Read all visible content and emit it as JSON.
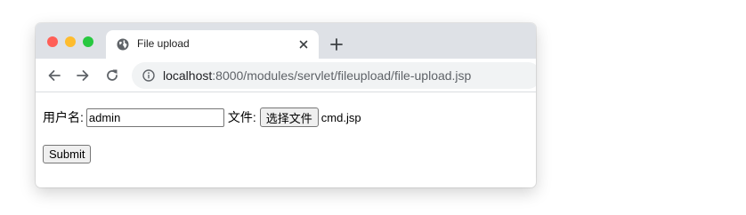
{
  "browser": {
    "tab": {
      "title": "File upload",
      "favicon": "globe-icon"
    },
    "address": {
      "host": "localhost",
      "rest": ":8000/modules/servlet/fileupload/file-upload.jsp"
    }
  },
  "form": {
    "username_label": "用户名:",
    "username_value": "admin",
    "file_label": "文件:",
    "choose_file_label": "选择文件",
    "file_name": "cmd.jsp",
    "submit_label": "Submit"
  }
}
